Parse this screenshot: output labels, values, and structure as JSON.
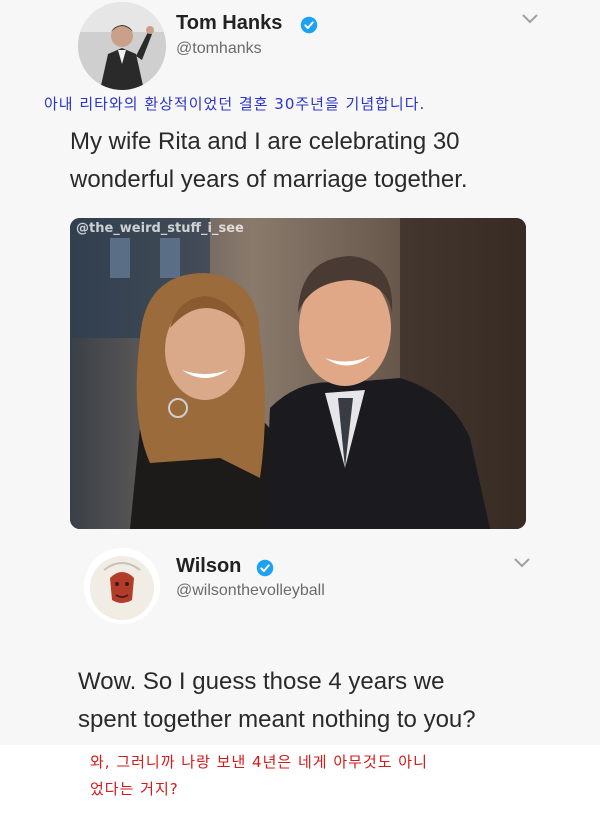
{
  "tweet": {
    "author_name": "Tom Hanks",
    "author_handle": "@tomhanks",
    "korean_translation": "아내 리타와의 환상적이었던 결혼 30주년을 기념합니다.",
    "text_line1": "My wife Rita and I are celebrating 30",
    "text_line2": "wonderful years of marriage together.",
    "photo_watermark": "@the_weird_stuff_i_see"
  },
  "reply": {
    "author_name": "Wilson",
    "author_handle": "@wilsonthevolleyball",
    "text_line1": "Wow. So I guess those 4 years we",
    "text_line2": "spent together meant nothing to you?",
    "korean_translation_line1": "와, 그러니까 나랑 보낸 4년은 네게 아무것도 아니",
    "korean_translation_line2": "었다는 거지?"
  },
  "colors": {
    "verified": "#1da1f2",
    "korean_top": "#2b34c9",
    "korean_bottom": "#d51818"
  }
}
